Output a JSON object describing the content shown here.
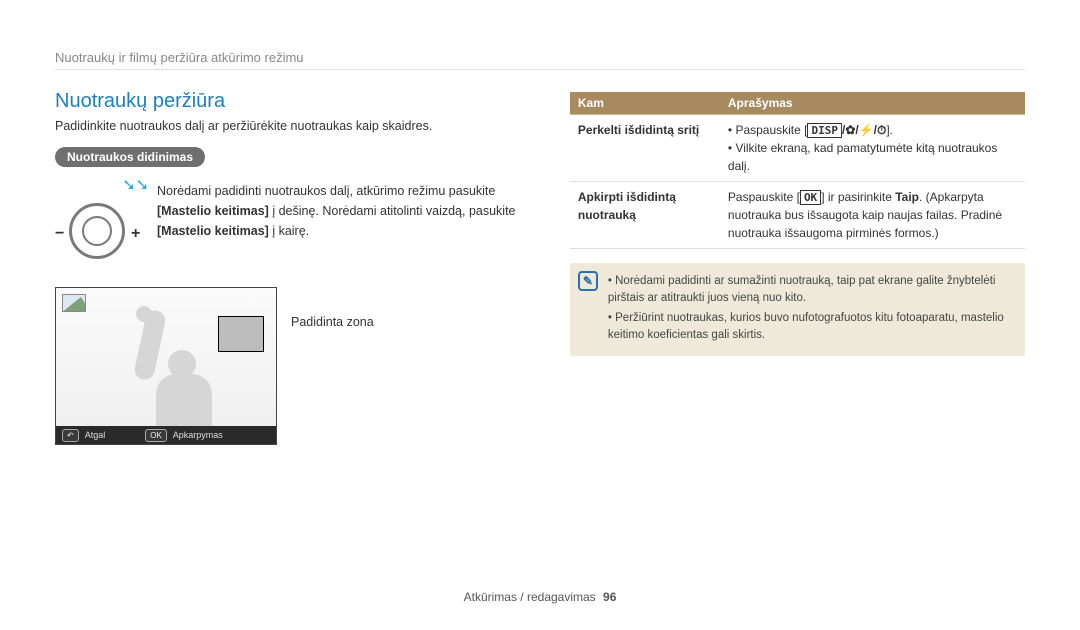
{
  "breadcrumb": "Nuotraukų ir filmų peržiūra atkūrimo režimu",
  "left": {
    "heading": "Nuotraukų peržiūra",
    "intro": "Padidinkite nuotraukos dalį ar peržiūrėkite nuotraukas kaip skaidres.",
    "subheading_pill": "Nuotraukos didinimas",
    "dial_text": {
      "line1": "Norėdami padidinti nuotraukos dalį, atkūrimo režimu pasukite ",
      "b1": "[Mastelio keitimas]",
      "mid": " į dešinę. Norėdami atitolinti vaizdą, pasukite ",
      "b2": "[Mastelio keitimas]",
      "end": " į kairę."
    },
    "preview_label": "Padidinta zona",
    "bar": {
      "back_key": "↶",
      "back_label": "Atgal",
      "ok_key": "OK",
      "ok_label": "Apkarpymas"
    }
  },
  "right": {
    "table": {
      "head_k": "Kam",
      "head_v": "Aprašymas",
      "row1": {
        "k": "Perkelti išdidintą sritį",
        "bullet1_pre": "Paspauskite [",
        "bullet1_btn": "DISP",
        "bullet1_syms": "/✿/⚡/⏱",
        "bullet1_post": "].",
        "bullet2": "Vilkite ekraną, kad pamatytumėte kitą nuotraukos dalį."
      },
      "row2": {
        "k": "Apkirpti išdidintą nuotrauką",
        "pre": "Paspauskite [",
        "btn": "OK",
        "mid": "] ir pasirinkite ",
        "bold": "Taip",
        "post": ". (Apkarpyta nuotrauka bus išsaugota kaip naujas failas. Pradinė nuotrauka išsaugoma pirminės formos.)"
      }
    },
    "note1": "Norėdami padidinti ar sumažinti nuotrauką, taip pat ekrane galite žnybtelėti pirštais ar atitraukti juos vieną nuo kito.",
    "note2": "Peržiūrint nuotraukas, kurios buvo nufotografuotos kitu fotoaparatu, mastelio keitimo koeficientas gali skirtis."
  },
  "footer": {
    "path": "Atkūrimas / redagavimas",
    "page": "96"
  }
}
